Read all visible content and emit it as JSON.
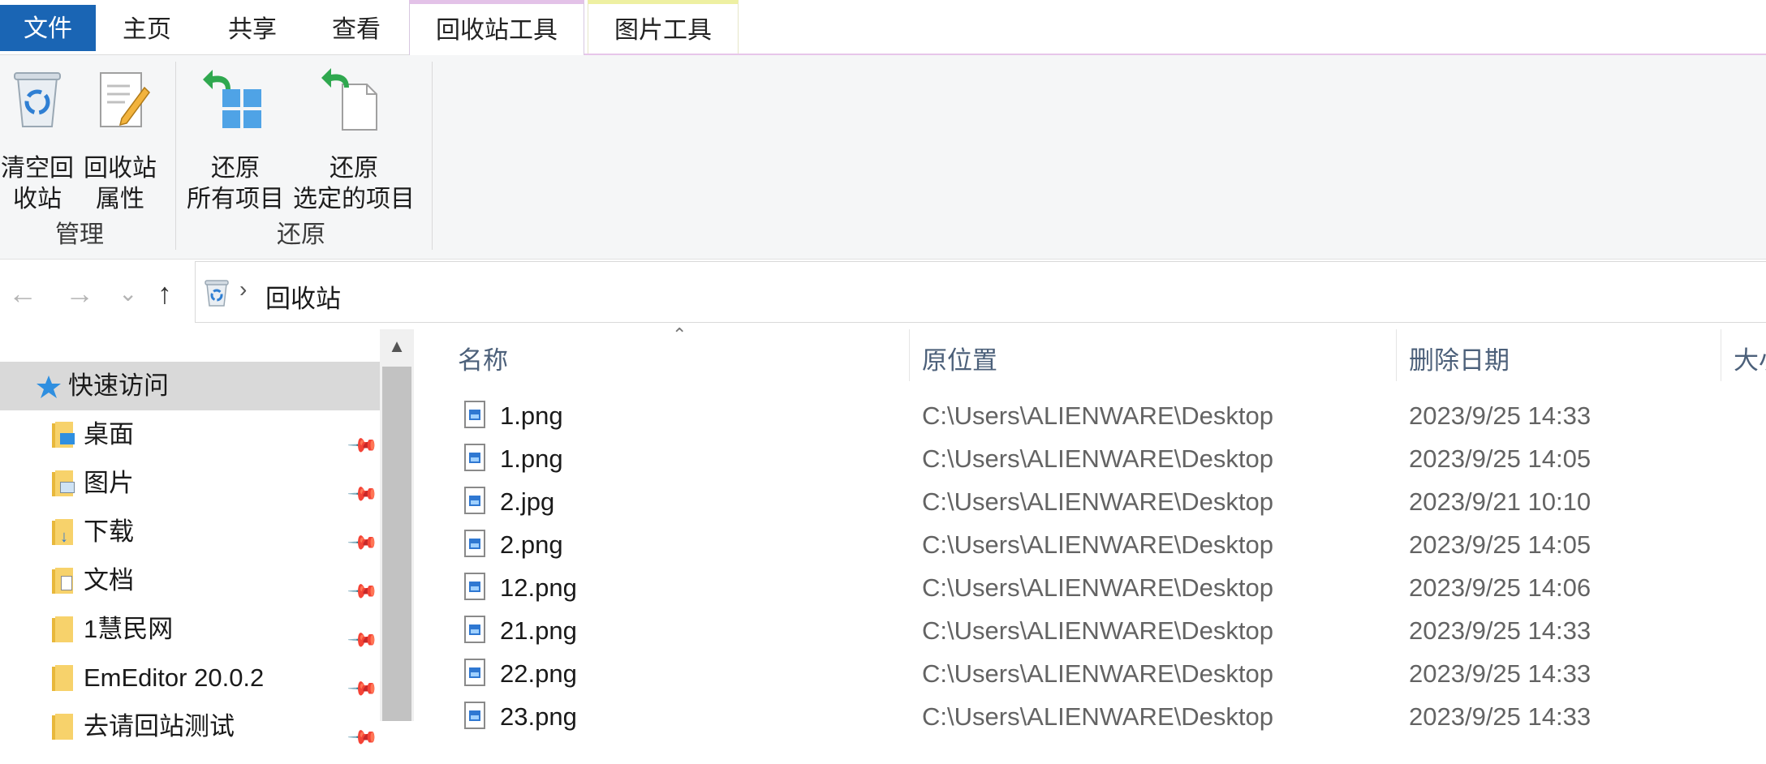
{
  "ribbon_tabs": {
    "file": "文件",
    "home": "主页",
    "share": "共享",
    "view": "查看",
    "recycle_tools": "回收站工具",
    "picture_tools": "图片工具"
  },
  "ribbon": {
    "empty_recycle_line1": "清空回",
    "empty_recycle_line2": "收站",
    "properties_line1": "回收站",
    "properties_line2": "属性",
    "restore_all_line1": "还原",
    "restore_all_line2": "所有项目",
    "restore_selected_line1": "还原",
    "restore_selected_line2": "选定的项目",
    "group_manage": "管理",
    "group_restore": "还原"
  },
  "navigation": {
    "back": "←",
    "forward": "→",
    "recent": "⌄",
    "up": "↑",
    "breadcrumb_sep": "›",
    "location": "回收站"
  },
  "nav_pane": {
    "quick_access": "快速访问",
    "items": [
      {
        "label": "桌面",
        "pinned": true
      },
      {
        "label": "图片",
        "pinned": true
      },
      {
        "label": "下载",
        "pinned": true
      },
      {
        "label": "文档",
        "pinned": true
      },
      {
        "label": "1慧民网",
        "pinned": true
      },
      {
        "label": "EmEditor 20.0.2",
        "pinned": true
      },
      {
        "label": "去请回站测试",
        "pinned": true
      }
    ]
  },
  "columns": {
    "name": "名称",
    "original_location": "原位置",
    "date_deleted": "删除日期",
    "size": "大小"
  },
  "files": [
    {
      "name": "1.png",
      "location": "C:\\Users\\ALIENWARE\\Desktop",
      "date": "2023/9/25 14:33"
    },
    {
      "name": "1.png",
      "location": "C:\\Users\\ALIENWARE\\Desktop",
      "date": "2023/9/25 14:05"
    },
    {
      "name": "2.jpg",
      "location": "C:\\Users\\ALIENWARE\\Desktop",
      "date": "2023/9/21 10:10"
    },
    {
      "name": "2.png",
      "location": "C:\\Users\\ALIENWARE\\Desktop",
      "date": "2023/9/25 14:05"
    },
    {
      "name": "12.png",
      "location": "C:\\Users\\ALIENWARE\\Desktop",
      "date": "2023/9/25 14:06"
    },
    {
      "name": "21.png",
      "location": "C:\\Users\\ALIENWARE\\Desktop",
      "date": "2023/9/25 14:33"
    },
    {
      "name": "22.png",
      "location": "C:\\Users\\ALIENWARE\\Desktop",
      "date": "2023/9/25 14:33"
    },
    {
      "name": "23.png",
      "location": "C:\\Users\\ALIENWARE\\Desktop",
      "date": "2023/9/25 14:33"
    }
  ],
  "colors": {
    "file_tab": "#1a65b4",
    "recycle_tools_accent": "#e3c2e8",
    "picture_tools_accent": "#eef0a2",
    "selection": "#d9d9d9",
    "header_text": "#4c607a"
  },
  "icons": {
    "recycle_bin": "recycle-bin-icon",
    "properties": "properties-icon",
    "restore_all": "restore-all-icon",
    "restore_selected": "restore-selected-icon",
    "quick_access": "star-icon",
    "pin": "pin-icon",
    "image_file": "image-file-icon"
  }
}
